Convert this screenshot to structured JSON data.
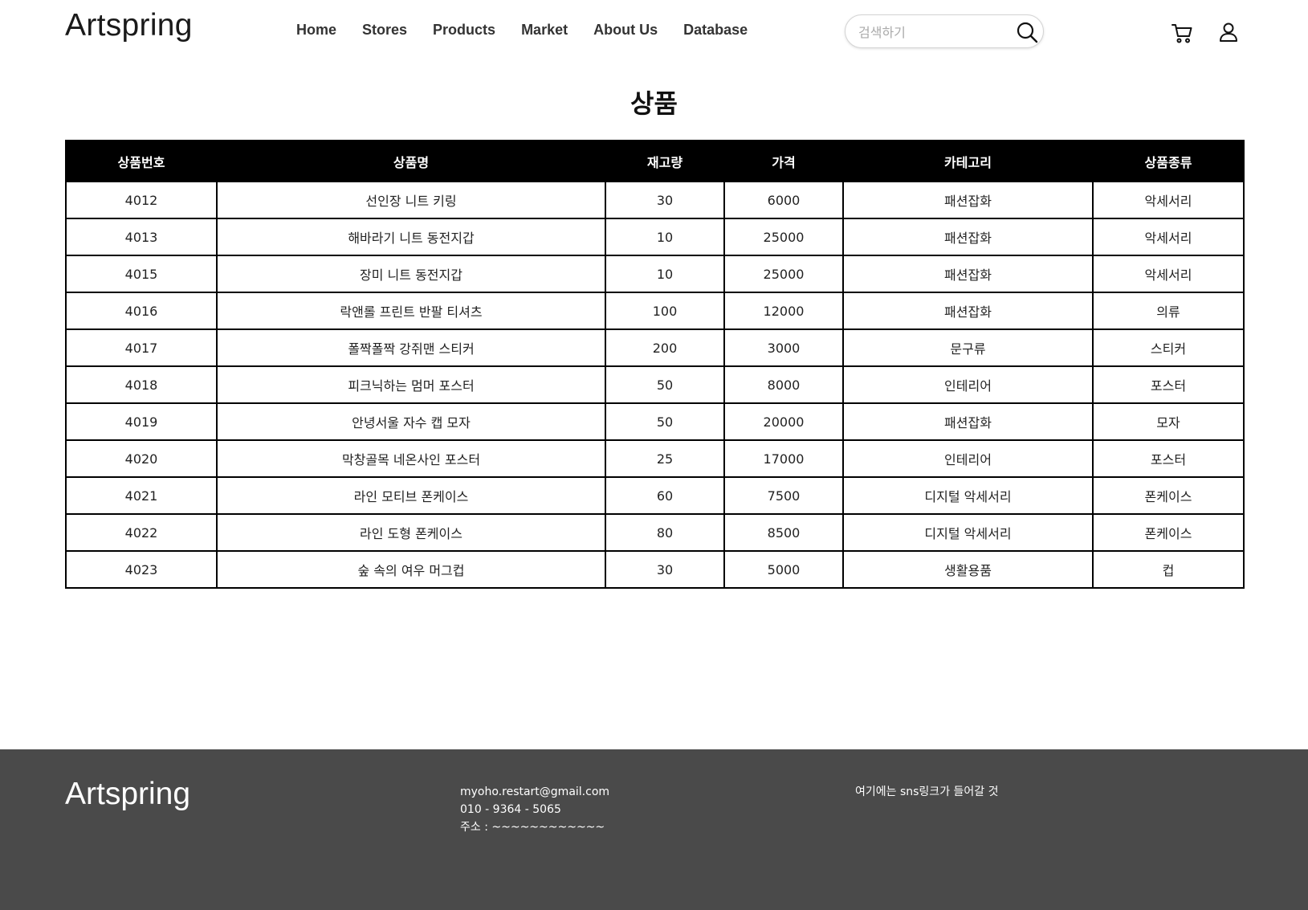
{
  "header": {
    "logo": "Artspring",
    "nav": [
      "Home",
      "Stores",
      "Products",
      "Market",
      "About Us",
      "Database"
    ],
    "search_placeholder": "검색하기",
    "icons": {
      "search": "search-icon",
      "cart": "cart-icon",
      "user": "user-icon"
    }
  },
  "page": {
    "title": "상품"
  },
  "table": {
    "headers": [
      "상품번호",
      "상품명",
      "재고량",
      "가격",
      "카테고리",
      "상품종류"
    ],
    "rows": [
      [
        "4012",
        "선인장 니트 키링",
        "30",
        "6000",
        "패션잡화",
        "악세서리"
      ],
      [
        "4013",
        "해바라기 니트 동전지갑",
        "10",
        "25000",
        "패션잡화",
        "악세서리"
      ],
      [
        "4015",
        "장미 니트 동전지갑",
        "10",
        "25000",
        "패션잡화",
        "악세서리"
      ],
      [
        "4016",
        "락앤롤 프린트 반팔 티셔츠",
        "100",
        "12000",
        "패션잡화",
        "의류"
      ],
      [
        "4017",
        "폴짝폴짝 강쥐맨 스티커",
        "200",
        "3000",
        "문구류",
        "스티커"
      ],
      [
        "4018",
        "피크닉하는 멈머 포스터",
        "50",
        "8000",
        "인테리어",
        "포스터"
      ],
      [
        "4019",
        "안녕서울 자수 캡 모자",
        "50",
        "20000",
        "패션잡화",
        "모자"
      ],
      [
        "4020",
        "막창골목 네온사인 포스터",
        "25",
        "17000",
        "인테리어",
        "포스터"
      ],
      [
        "4021",
        "라인 모티브 폰케이스",
        "60",
        "7500",
        "디지털 악세서리",
        "폰케이스"
      ],
      [
        "4022",
        "라인 도형 폰케이스",
        "80",
        "8500",
        "디지털 악세서리",
        "폰케이스"
      ],
      [
        "4023",
        "숲 속의 여우 머그컵",
        "30",
        "5000",
        "생활용품",
        "컵"
      ]
    ]
  },
  "footer": {
    "logo": "Artspring",
    "email": "myoho.restart@gmail.com",
    "phone": "010 - 9364 - 5065",
    "address": "주소 : ~~~~~~~~~~~~",
    "sns": "여기에는 sns링크가 들어갈 것"
  },
  "colors": {
    "header_bg": "#000000",
    "footer_bg": "#4a4a4a",
    "text": "#111111"
  }
}
